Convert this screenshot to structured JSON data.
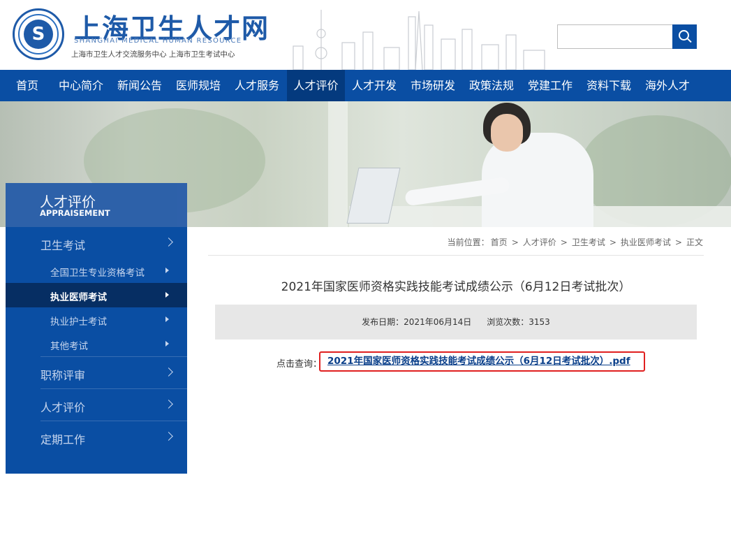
{
  "header": {
    "logo_emblem_glyph": "S",
    "site_title": "上海卫生人才网",
    "site_subtitle_en": "SHANGHAI MEDICAL HUMAN RESOURCE",
    "site_subtitle_cn": "上海市卫生人才交流服务中心  上海市卫生考试中心",
    "search": {
      "value": "",
      "placeholder": ""
    }
  },
  "nav": {
    "items": [
      {
        "label": "首页"
      },
      {
        "label": "中心简介"
      },
      {
        "label": "新闻公告"
      },
      {
        "label": "医师规培"
      },
      {
        "label": "人才服务"
      },
      {
        "label": "人才评价"
      },
      {
        "label": "人才开发"
      },
      {
        "label": "市场研发"
      },
      {
        "label": "政策法规"
      },
      {
        "label": "党建工作"
      },
      {
        "label": "资料下载"
      },
      {
        "label": "海外人才"
      }
    ],
    "active_label": "人才评价"
  },
  "sidebar": {
    "title": "人才评价",
    "subtitle": "APPRAISEMENT",
    "items": [
      {
        "label": "卫生考试"
      },
      {
        "label": "全国卫生专业资格考试"
      },
      {
        "label": "执业医师考试"
      },
      {
        "label": "执业护士考试"
      },
      {
        "label": "其他考试"
      },
      {
        "label": "职称评审"
      },
      {
        "label": "人才评价"
      },
      {
        "label": "定期工作"
      }
    ],
    "active_label": "执业医师考试"
  },
  "breadcrumb": {
    "prefix": "当前位置：",
    "items": [
      "首页",
      "人才评价",
      "卫生考试",
      "执业医师考试",
      "正文"
    ],
    "separator": ">"
  },
  "article": {
    "title": "2021年国家医师资格实践技能考试成绩公示（6月12日考试批次）",
    "publish_date_label": "发布日期：",
    "publish_date": "2021年06月14日",
    "views_label": "浏览次数：",
    "views": "3153",
    "query_label": "点击查询：",
    "file_link_text": "2021年国家医师资格实践技能考试成绩公示（6月12日考试批次）.pdf"
  },
  "colors": {
    "brand_blue": "#0a4ea3",
    "nav_active": "#043a7e",
    "sidebar_active": "#062e63",
    "highlight_border": "#e02020",
    "link_text": "#0a3f8a"
  }
}
